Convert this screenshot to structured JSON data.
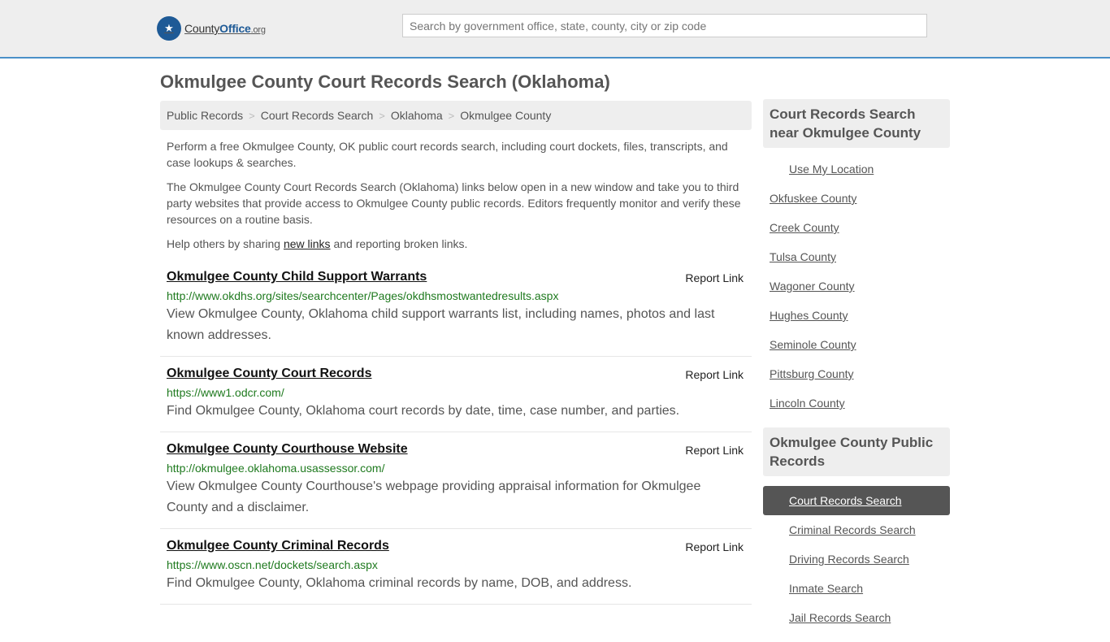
{
  "header": {
    "logo_glyph": "★",
    "logo_icon": "eagle-seal-icon",
    "logo_prefix": "County",
    "logo_strong": "Office",
    "logo_ext": ".org",
    "search_placeholder": "Search by government office, state, county, city or zip code"
  },
  "page": {
    "title": "Okmulgee County Court Records Search (Oklahoma)"
  },
  "breadcrumb": [
    "Public Records",
    "Court Records Search",
    "Oklahoma",
    "Okmulgee County"
  ],
  "breadcrumb_separator": ">",
  "intro": {
    "p1": "Perform a free Okmulgee County, OK public court records search, including court dockets, files, transcripts, and case lookups & searches.",
    "p2": "The Okmulgee County Court Records Search (Oklahoma) links below open in a new window and take you to third party websites that provide access to Okmulgee County public records. Editors frequently monitor and verify these resources on a routine basis.",
    "p3_before": "Help others by sharing ",
    "p3_link": "new links",
    "p3_after": " and reporting broken links."
  },
  "results": [
    {
      "title": "Okmulgee County Child Support Warrants",
      "report": "Report Link",
      "url": "http://www.okdhs.org/sites/searchcenter/Pages/okdhsmostwantedresults.aspx",
      "desc": "View Okmulgee County, Oklahoma child support warrants list, including names, photos and last known addresses."
    },
    {
      "title": "Okmulgee County Court Records",
      "report": "Report Link",
      "url": "https://www1.odcr.com/",
      "desc": "Find Okmulgee County, Oklahoma court records by date, time, case number, and parties."
    },
    {
      "title": "Okmulgee County Courthouse Website",
      "report": "Report Link",
      "url": "http://okmulgee.oklahoma.usassessor.com/",
      "desc": "View Okmulgee County Courthouse's webpage providing appraisal information for Okmulgee County and a disclaimer."
    },
    {
      "title": "Okmulgee County Criminal Records",
      "report": "Report Link",
      "url": "https://www.oscn.net/dockets/search.aspx",
      "desc": "Find Okmulgee County, Oklahoma criminal records by name, DOB, and address."
    }
  ],
  "sidebar": {
    "near_heading": "Court Records Search near Okmulgee County",
    "use_location": "Use My Location",
    "near_items": [
      "Okfuskee County",
      "Creek County",
      "Tulsa County",
      "Wagoner County",
      "Hughes County",
      "Seminole County",
      "Pittsburg County",
      "Lincoln County"
    ],
    "public_heading": "Okmulgee County Public Records",
    "public_items": [
      "Court Records Search",
      "Criminal Records Search",
      "Driving Records Search",
      "Inmate Search",
      "Jail Records Search"
    ],
    "active_item": "Court Records Search",
    "active_color": "#555555"
  },
  "colors": {
    "url_green": "#1f7a1f",
    "header_bg": "#eeeeee",
    "header_border": "#4a90c8",
    "logo_blue": "#1e5a96"
  }
}
